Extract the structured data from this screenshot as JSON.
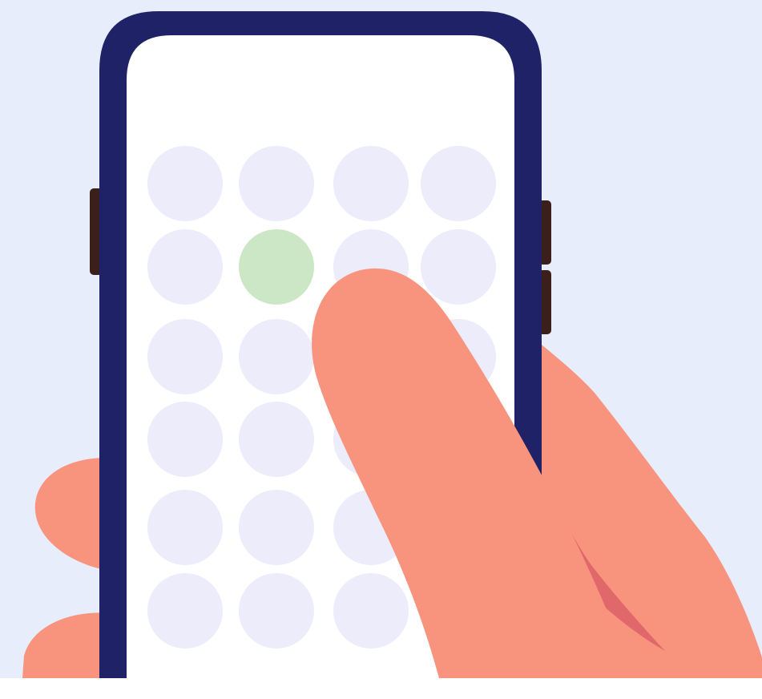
{
  "illustration": {
    "subject": "hand-holding-phone",
    "grid": {
      "rows": 6,
      "columns": 4,
      "highlighted": [
        {
          "row": 2,
          "column": 2
        }
      ]
    },
    "colors": {
      "background": "#e8edfb",
      "bottom_strip": "#ffffff",
      "phone_frame": "#1f2266",
      "phone_screen": "#ffffff",
      "side_buttons": "#3a1f1a",
      "dot_default": "#ececfb",
      "dot_highlight": "#cce7c5",
      "skin": "#f8937e",
      "skin_shadow": "#e0686a"
    }
  }
}
